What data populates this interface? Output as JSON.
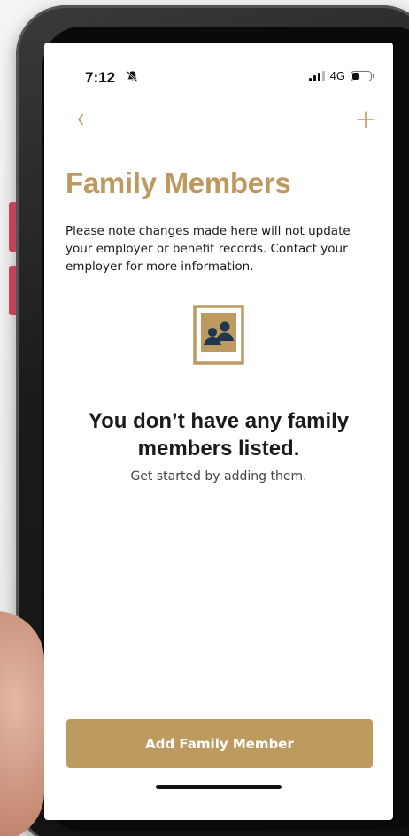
{
  "status_bar": {
    "time": "7:12",
    "network": "4G",
    "icons": [
      "bell-slash-icon",
      "signal-icon",
      "battery-icon"
    ]
  },
  "nav": {
    "back_icon": "chevron-left-icon",
    "add_icon": "plus-icon"
  },
  "page": {
    "title": "Family Members",
    "notice": "Please note changes made here will not update your employer or benefit records. Contact your employer for more information."
  },
  "empty_state": {
    "icon": "family-portrait-icon",
    "title": "You don’t have any family members listed.",
    "subtitle": "Get started by adding them."
  },
  "actions": {
    "add_family_member_label": "Add Family Member"
  },
  "colors": {
    "accent": "#bd9a60",
    "icon_navy": "#1f3550",
    "text": "#1a1a1a"
  }
}
